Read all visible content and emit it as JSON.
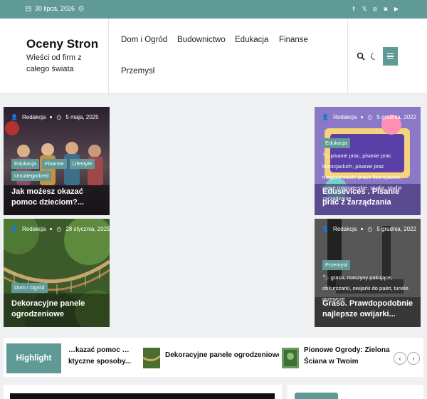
{
  "topbar": {
    "date": "30 lipca, 2026",
    "socials": [
      "f",
      "𝕏",
      "◎",
      "◙",
      "▶"
    ]
  },
  "header": {
    "site_title": "Oceny Stron",
    "tagline": "Wieści od firm z całego świata",
    "nav": [
      "Dom i Ogród",
      "Budownictwo",
      "Edukacja",
      "Finanse",
      "Przemysł"
    ]
  },
  "cards": [
    {
      "author": "Redakcja",
      "date": "5 maja, 2025",
      "tags": [
        "Edukacja",
        "Finanse",
        "Lifestyle",
        "Uncategorized"
      ],
      "tag_text": "",
      "title": "Jak możesz okazać pomoc dzieciom?..."
    },
    {
      "author": "Redakcja",
      "date": "28 stycznia, 2025",
      "tags": [
        "Dom i Ogród"
      ],
      "tag_text": "",
      "title": "Dekoracyjne panele ogrodzeniowe"
    },
    {
      "author": "Redakcja",
      "date": "5 grudnia, 2022",
      "tags": [
        "Edukacja"
      ],
      "tag_text": "pisanie prac, pisanie prac licencjackich, pisanie prac magisterskich, prace licencjackie, prace magisterskie, studia, studia zarządzanie",
      "title": "Edusevices . Pisanie prac z zarządzania"
    },
    {
      "author": "Redakcja",
      "date": "5 grudnia, 2022",
      "tags": [
        "Przemysł"
      ],
      "tag_text": "graso, maszyny pakujące, obkurczarki, owijarki do palet, tunele grzewcze",
      "title": "Graso. Prawdopodobnie najlepsze owijarki..."
    }
  ],
  "highlight": {
    "label": "Highlight",
    "items": [
      {
        "title": "…kazać pomoc …ktyczne sposoby..."
      },
      {
        "title": "Dekoracyjne panele ogrodzeniowe"
      },
      {
        "title": "Pionowe Ogrody: Zielona Ściana w Twoim Ogrodzie i na Balkonie"
      }
    ],
    "prev": "‹",
    "next": "›"
  },
  "colors": {
    "accent": "#5f9a97"
  }
}
